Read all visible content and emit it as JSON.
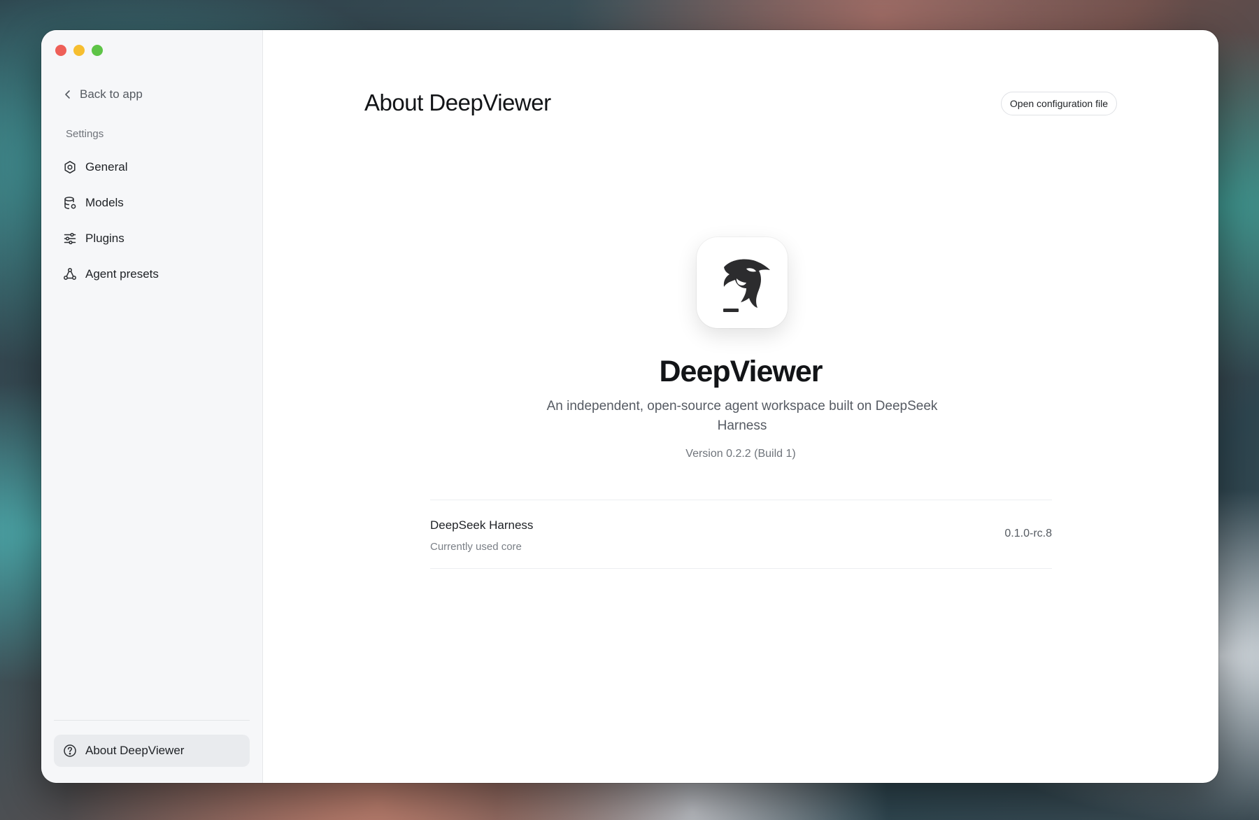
{
  "sidebar": {
    "back_label": "Back to app",
    "section_label": "Settings",
    "items": [
      {
        "label": "General",
        "icon": "gear-icon"
      },
      {
        "label": "Models",
        "icon": "database-icon"
      },
      {
        "label": "Plugins",
        "icon": "sliders-icon"
      },
      {
        "label": "Agent presets",
        "icon": "agents-icon"
      }
    ],
    "about_label": "About DeepViewer",
    "about_icon": "question-circle-icon"
  },
  "main": {
    "title": "About DeepViewer",
    "open_config_label": "Open configuration file",
    "app_name": "DeepViewer",
    "tagline": "An independent, open-source agent workspace built on DeepSeek Harness",
    "version": "Version 0.2.2 (Build 1)",
    "core": {
      "name": "DeepSeek Harness",
      "description": "Currently used core",
      "version": "0.1.0-rc.8"
    }
  },
  "colors": {
    "close": "#ee5f58",
    "minimize": "#f6be30",
    "maximize": "#5ec447",
    "sidebar_bg": "#f6f7f9",
    "active_item_bg": "#e9ebee"
  }
}
